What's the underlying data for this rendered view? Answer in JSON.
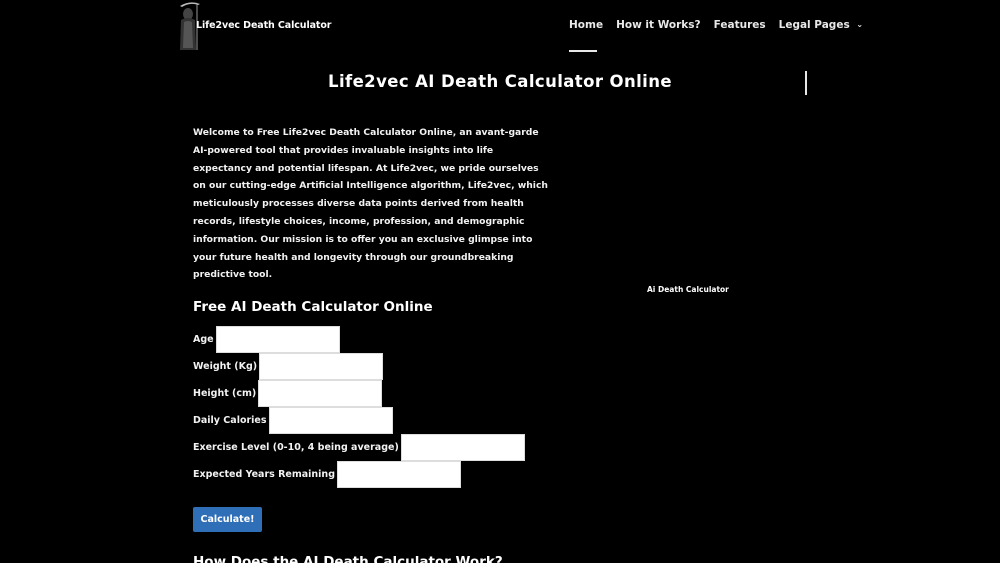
{
  "header": {
    "logo_text": "Life2vec Death Calculator",
    "logo_icon": "grim-reaper-icon",
    "nav": [
      {
        "label": "Home",
        "active": true
      },
      {
        "label": "How it Works?"
      },
      {
        "label": "Features"
      },
      {
        "label": "Legal Pages",
        "has_dropdown": true
      }
    ]
  },
  "main": {
    "title": "Life2vec AI Death Calculator Online",
    "intro": "Welcome to Free Life2vec Death Calculator Online, an avant-garde AI-powered tool that provides invaluable insights into life expectancy and potential lifespan. At Life2vec, we pride ourselves on our cutting-edge Artificial Intelligence algorithm, Life2vec, which meticulously processes diverse data points derived from health records, lifestyle choices, income, profession, and demographic information. Our mission is to offer you an exclusive glimpse into your future health and longevity through our groundbreaking predictive tool.",
    "image_caption": "Ai Death Calculator"
  },
  "form": {
    "title": "Free AI Death Calculator Online",
    "fields": [
      {
        "label": "Age",
        "value": ""
      },
      {
        "label": "Weight (Kg)",
        "value": ""
      },
      {
        "label": "Height (cm)",
        "value": ""
      },
      {
        "label": "Daily Calories",
        "value": ""
      },
      {
        "label": "Exercise Level (0-10, 4 being average)",
        "value": ""
      },
      {
        "label": "Expected Years Remaining",
        "value": ""
      }
    ],
    "submit_label": "Calculate!"
  },
  "next_section": {
    "heading": "How Does the AI Death Calculator Work?"
  },
  "colors": {
    "background": "#000000",
    "text": "#ffffff",
    "button": "#2f6fb8"
  }
}
